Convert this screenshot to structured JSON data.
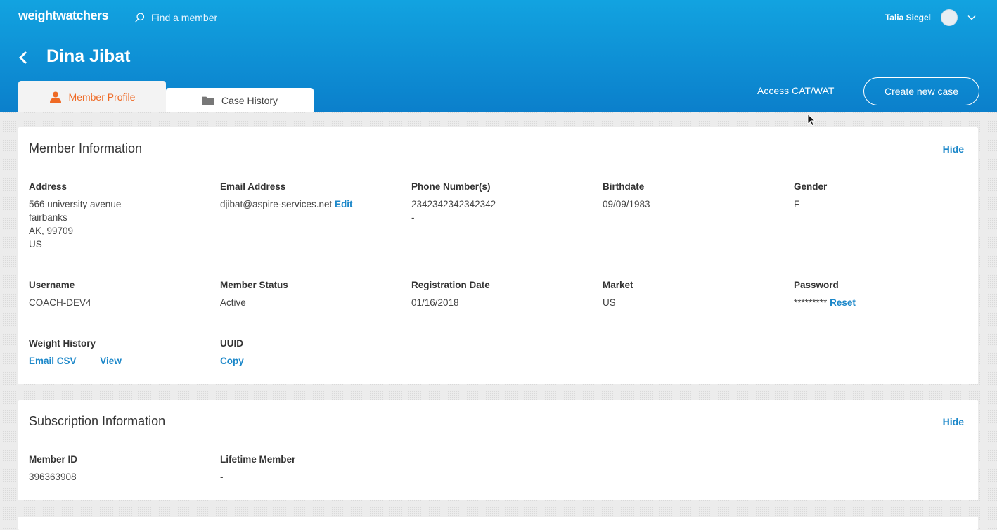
{
  "header": {
    "logo_text": "weightwatchers",
    "search_placeholder": "Find a member",
    "user_name": "Talia Siegel"
  },
  "member": {
    "name": "Dina Jibat"
  },
  "tabs": [
    {
      "label": "Member Profile",
      "active": true
    },
    {
      "label": "Case History",
      "active": false
    }
  ],
  "actions": {
    "access_label": "Access CAT/WAT",
    "create_case_label": "Create new case"
  },
  "member_info": {
    "title": "Member Information",
    "hide_label": "Hide",
    "address": {
      "label": "Address",
      "lines": [
        "566 university avenue",
        "fairbanks",
        "AK, 99709",
        "US"
      ]
    },
    "email": {
      "label": "Email Address",
      "value": "djibat@aspire-services.net",
      "edit_label": "Edit"
    },
    "phone": {
      "label": "Phone Number(s)",
      "lines": [
        "2342342342342342",
        "-"
      ]
    },
    "birthdate": {
      "label": "Birthdate",
      "value": "09/09/1983"
    },
    "gender": {
      "label": "Gender",
      "value": "F"
    },
    "username": {
      "label": "Username",
      "value": "COACH-DEV4"
    },
    "status": {
      "label": "Member Status",
      "value": "Active"
    },
    "registration": {
      "label": "Registration Date",
      "value": "01/16/2018"
    },
    "market": {
      "label": "Market",
      "value": "US"
    },
    "password": {
      "label": "Password",
      "value": "*********",
      "reset_label": "Reset"
    },
    "weight_history": {
      "label": "Weight History",
      "email_csv_label": "Email CSV",
      "view_label": "View"
    },
    "uuid": {
      "label": "UUID",
      "copy_label": "Copy"
    }
  },
  "subscription_info": {
    "title": "Subscription Information",
    "hide_label": "Hide",
    "member_id": {
      "label": "Member ID",
      "value": "396363908"
    },
    "lifetime": {
      "label": "Lifetime Member",
      "value": "-"
    }
  },
  "colors": {
    "header_top": "#12a3e0",
    "header_bottom": "#0b7fcb",
    "link": "#1b87c9",
    "active_tab": "#ef6a25"
  }
}
